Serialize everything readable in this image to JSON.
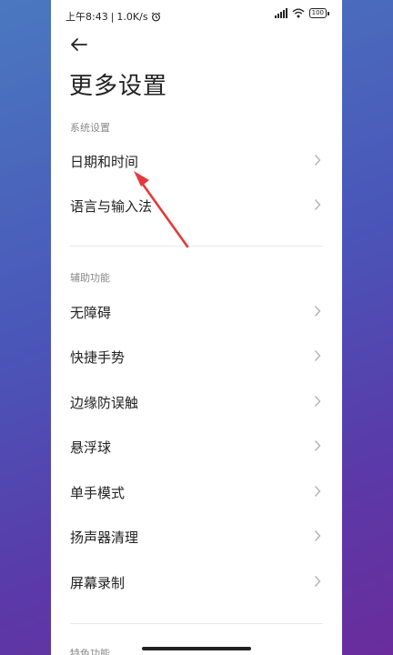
{
  "status_bar": {
    "time": "上午8:43",
    "net_speed": "1.0K/s",
    "battery_level": "100"
  },
  "header": {
    "title": "更多设置"
  },
  "sections": [
    {
      "header": "系统设置",
      "items": [
        {
          "label": "日期和时间"
        },
        {
          "label": "语言与输入法"
        }
      ]
    },
    {
      "header": "辅助功能",
      "items": [
        {
          "label": "无障碍"
        },
        {
          "label": "快捷手势"
        },
        {
          "label": "边缘防误触"
        },
        {
          "label": "悬浮球"
        },
        {
          "label": "单手模式"
        },
        {
          "label": "扬声器清理"
        },
        {
          "label": "屏幕录制"
        }
      ]
    },
    {
      "header": "特色功能",
      "items": []
    }
  ],
  "colors": {
    "annotation_arrow": "#e53a3a",
    "section_header": "#8a8a8a",
    "text": "#222222"
  }
}
